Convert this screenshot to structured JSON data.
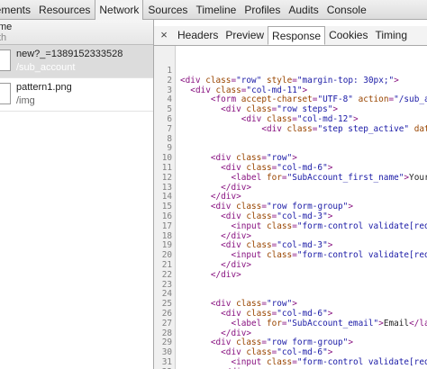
{
  "top_tabs": [
    {
      "label": "lements",
      "active": false
    },
    {
      "label": "Resources",
      "active": false
    },
    {
      "label": "Network",
      "active": true
    },
    {
      "label": "Sources",
      "active": false
    },
    {
      "label": "Timeline",
      "active": false
    },
    {
      "label": "Profiles",
      "active": false
    },
    {
      "label": "Audits",
      "active": false
    },
    {
      "label": "Console",
      "active": false
    }
  ],
  "left": {
    "header_name": "me",
    "header_path": "th",
    "requests": [
      {
        "name": "new?_=1389152333528",
        "path": "/sub_account",
        "selected": true
      },
      {
        "name": "pattern1.png",
        "path": "/img",
        "selected": false
      }
    ]
  },
  "detail": {
    "close_glyph": "×",
    "tabs": [
      {
        "label": "Headers",
        "active": false
      },
      {
        "label": "Preview",
        "active": false
      },
      {
        "label": "Response",
        "active": true
      },
      {
        "label": "Cookies",
        "active": false
      },
      {
        "label": "Timing",
        "active": false
      }
    ]
  },
  "code_lines": [
    {
      "num": "1",
      "segs": []
    },
    {
      "num": "2",
      "segs": [
        {
          "c": "tag",
          "t": "<div "
        },
        {
          "c": "attr",
          "t": "class"
        },
        {
          "c": "tag",
          "t": "="
        },
        {
          "c": "val",
          "t": "\"row\""
        },
        {
          "c": "attr",
          "t": " style"
        },
        {
          "c": "tag",
          "t": "="
        },
        {
          "c": "val",
          "t": "\"margin-top: 30px;\""
        },
        {
          "c": "tag",
          "t": ">"
        }
      ]
    },
    {
      "num": "3",
      "segs": [
        {
          "c": "txt",
          "t": "  "
        },
        {
          "c": "tag",
          "t": "<div "
        },
        {
          "c": "attr",
          "t": "class"
        },
        {
          "c": "tag",
          "t": "="
        },
        {
          "c": "val",
          "t": "\"col-md-11\""
        },
        {
          "c": "tag",
          "t": ">"
        }
      ]
    },
    {
      "num": "4",
      "segs": [
        {
          "c": "txt",
          "t": "      "
        },
        {
          "c": "tag",
          "t": "<form "
        },
        {
          "c": "attr",
          "t": "accept-charset"
        },
        {
          "c": "tag",
          "t": "="
        },
        {
          "c": "val",
          "t": "\"UTF-8\""
        },
        {
          "c": "attr",
          "t": " action"
        },
        {
          "c": "tag",
          "t": "="
        },
        {
          "c": "val",
          "t": "\"/sub_accou"
        }
      ]
    },
    {
      "num": "5",
      "segs": [
        {
          "c": "txt",
          "t": "        "
        },
        {
          "c": "tag",
          "t": "<div "
        },
        {
          "c": "attr",
          "t": "class"
        },
        {
          "c": "tag",
          "t": "="
        },
        {
          "c": "val",
          "t": "\"row steps\""
        },
        {
          "c": "tag",
          "t": ">"
        }
      ]
    },
    {
      "num": "6",
      "segs": [
        {
          "c": "txt",
          "t": "            "
        },
        {
          "c": "tag",
          "t": "<div "
        },
        {
          "c": "attr",
          "t": "class"
        },
        {
          "c": "tag",
          "t": "="
        },
        {
          "c": "val",
          "t": "\"col-md-12\""
        },
        {
          "c": "tag",
          "t": ">"
        }
      ]
    },
    {
      "num": "7",
      "segs": [
        {
          "c": "txt",
          "t": "                "
        },
        {
          "c": "tag",
          "t": "<div "
        },
        {
          "c": "attr",
          "t": "class"
        },
        {
          "c": "tag",
          "t": "="
        },
        {
          "c": "val",
          "t": "\"step step_active\""
        },
        {
          "c": "attr",
          "t": " data-ste"
        }
      ]
    },
    {
      "num": "8",
      "segs": []
    },
    {
      "num": "9",
      "segs": []
    },
    {
      "num": "10",
      "segs": [
        {
          "c": "txt",
          "t": "      "
        },
        {
          "c": "tag",
          "t": "<div "
        },
        {
          "c": "attr",
          "t": "class"
        },
        {
          "c": "tag",
          "t": "="
        },
        {
          "c": "val",
          "t": "\"row\""
        },
        {
          "c": "tag",
          "t": ">"
        }
      ]
    },
    {
      "num": "11",
      "segs": [
        {
          "c": "txt",
          "t": "        "
        },
        {
          "c": "tag",
          "t": "<div "
        },
        {
          "c": "attr",
          "t": "class"
        },
        {
          "c": "tag",
          "t": "="
        },
        {
          "c": "val",
          "t": "\"col-md-6\""
        },
        {
          "c": "tag",
          "t": ">"
        }
      ]
    },
    {
      "num": "12",
      "segs": [
        {
          "c": "txt",
          "t": "          "
        },
        {
          "c": "tag",
          "t": "<label "
        },
        {
          "c": "attr",
          "t": "for"
        },
        {
          "c": "tag",
          "t": "="
        },
        {
          "c": "val",
          "t": "\"SubAccount_first_name\""
        },
        {
          "c": "tag",
          "t": ">"
        },
        {
          "c": "txt",
          "t": "Your Na"
        }
      ]
    },
    {
      "num": "13",
      "segs": [
        {
          "c": "txt",
          "t": "        "
        },
        {
          "c": "tag",
          "t": "</div>"
        }
      ]
    },
    {
      "num": "14",
      "segs": [
        {
          "c": "txt",
          "t": "      "
        },
        {
          "c": "tag",
          "t": "</div>"
        }
      ]
    },
    {
      "num": "15",
      "segs": [
        {
          "c": "txt",
          "t": "      "
        },
        {
          "c": "tag",
          "t": "<div "
        },
        {
          "c": "attr",
          "t": "class"
        },
        {
          "c": "tag",
          "t": "="
        },
        {
          "c": "val",
          "t": "\"row form-group\""
        },
        {
          "c": "tag",
          "t": ">"
        }
      ]
    },
    {
      "num": "16",
      "segs": [
        {
          "c": "txt",
          "t": "        "
        },
        {
          "c": "tag",
          "t": "<div "
        },
        {
          "c": "attr",
          "t": "class"
        },
        {
          "c": "tag",
          "t": "="
        },
        {
          "c": "val",
          "t": "\"col-md-3\""
        },
        {
          "c": "tag",
          "t": ">"
        }
      ]
    },
    {
      "num": "17",
      "segs": [
        {
          "c": "txt",
          "t": "          "
        },
        {
          "c": "tag",
          "t": "<input "
        },
        {
          "c": "attr",
          "t": "class"
        },
        {
          "c": "tag",
          "t": "="
        },
        {
          "c": "val",
          "t": "\"form-control validate[requir"
        }
      ]
    },
    {
      "num": "18",
      "segs": [
        {
          "c": "txt",
          "t": "        "
        },
        {
          "c": "tag",
          "t": "</div>"
        }
      ]
    },
    {
      "num": "19",
      "segs": [
        {
          "c": "txt",
          "t": "        "
        },
        {
          "c": "tag",
          "t": "<div "
        },
        {
          "c": "attr",
          "t": "class"
        },
        {
          "c": "tag",
          "t": "="
        },
        {
          "c": "val",
          "t": "\"col-md-3\""
        },
        {
          "c": "tag",
          "t": ">"
        }
      ]
    },
    {
      "num": "20",
      "segs": [
        {
          "c": "txt",
          "t": "          "
        },
        {
          "c": "tag",
          "t": "<input "
        },
        {
          "c": "attr",
          "t": "class"
        },
        {
          "c": "tag",
          "t": "="
        },
        {
          "c": "val",
          "t": "\"form-control validate[requir"
        }
      ]
    },
    {
      "num": "21",
      "segs": [
        {
          "c": "txt",
          "t": "        "
        },
        {
          "c": "tag",
          "t": "</div>"
        }
      ]
    },
    {
      "num": "22",
      "segs": [
        {
          "c": "txt",
          "t": "      "
        },
        {
          "c": "tag",
          "t": "</div>"
        }
      ]
    },
    {
      "num": "23",
      "segs": []
    },
    {
      "num": "24",
      "segs": []
    },
    {
      "num": "25",
      "segs": [
        {
          "c": "txt",
          "t": "      "
        },
        {
          "c": "tag",
          "t": "<div "
        },
        {
          "c": "attr",
          "t": "class"
        },
        {
          "c": "tag",
          "t": "="
        },
        {
          "c": "val",
          "t": "\"row\""
        },
        {
          "c": "tag",
          "t": ">"
        }
      ]
    },
    {
      "num": "26",
      "segs": [
        {
          "c": "txt",
          "t": "        "
        },
        {
          "c": "tag",
          "t": "<div "
        },
        {
          "c": "attr",
          "t": "class"
        },
        {
          "c": "tag",
          "t": "="
        },
        {
          "c": "val",
          "t": "\"col-md-6\""
        },
        {
          "c": "tag",
          "t": ">"
        }
      ]
    },
    {
      "num": "27",
      "segs": [
        {
          "c": "txt",
          "t": "          "
        },
        {
          "c": "tag",
          "t": "<label "
        },
        {
          "c": "attr",
          "t": "for"
        },
        {
          "c": "tag",
          "t": "="
        },
        {
          "c": "val",
          "t": "\"SubAccount_email\""
        },
        {
          "c": "tag",
          "t": ">"
        },
        {
          "c": "txt",
          "t": "Email"
        },
        {
          "c": "tag",
          "t": "</label"
        }
      ]
    },
    {
      "num": "28",
      "segs": [
        {
          "c": "txt",
          "t": "        "
        },
        {
          "c": "tag",
          "t": "</div>"
        }
      ]
    },
    {
      "num": "29",
      "segs": [
        {
          "c": "txt",
          "t": "      "
        },
        {
          "c": "tag",
          "t": "<div "
        },
        {
          "c": "attr",
          "t": "class"
        },
        {
          "c": "tag",
          "t": "="
        },
        {
          "c": "val",
          "t": "\"row form-group\""
        },
        {
          "c": "tag",
          "t": ">"
        }
      ]
    },
    {
      "num": "30",
      "segs": [
        {
          "c": "txt",
          "t": "        "
        },
        {
          "c": "tag",
          "t": "<div "
        },
        {
          "c": "attr",
          "t": "class"
        },
        {
          "c": "tag",
          "t": "="
        },
        {
          "c": "val",
          "t": "\"col-md-6\""
        },
        {
          "c": "tag",
          "t": ">"
        }
      ]
    },
    {
      "num": "31",
      "segs": [
        {
          "c": "txt",
          "t": "          "
        },
        {
          "c": "tag",
          "t": "<input "
        },
        {
          "c": "attr",
          "t": "class"
        },
        {
          "c": "tag",
          "t": "="
        },
        {
          "c": "val",
          "t": "\"form-control validate[requir"
        }
      ]
    },
    {
      "num": "32",
      "segs": [
        {
          "c": "txt",
          "t": "        "
        },
        {
          "c": "tag",
          "t": "</div>"
        }
      ]
    },
    {
      "num": "33",
      "segs": [
        {
          "c": "txt",
          "t": "      "
        },
        {
          "c": "tag",
          "t": "</div>"
        }
      ]
    }
  ]
}
